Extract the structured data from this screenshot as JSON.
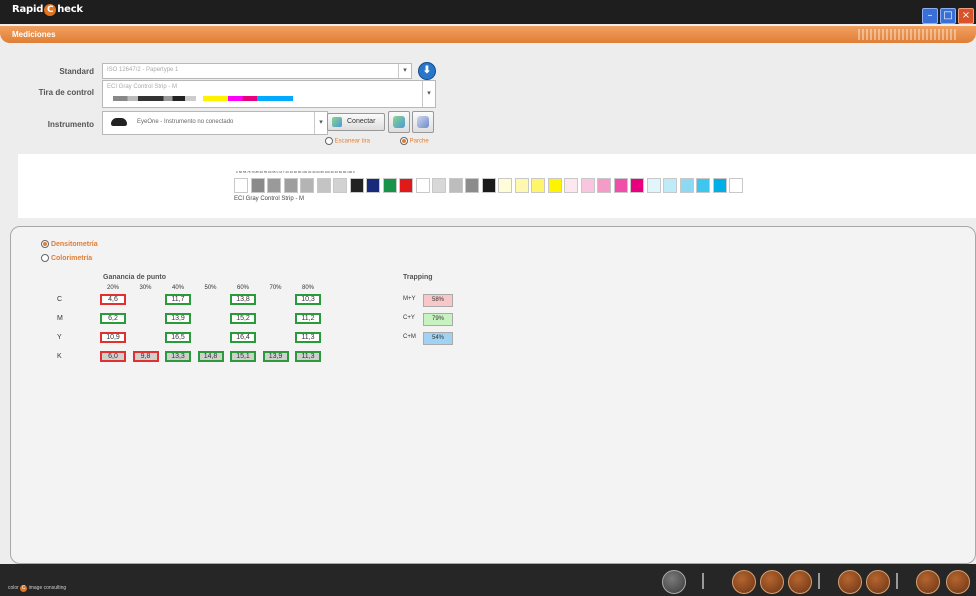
{
  "app": {
    "title_pre": "Rapid",
    "title_c": "C",
    "title_post": "heck"
  },
  "tab": {
    "label": "Mediciones"
  },
  "form": {
    "standard_label": "Standard",
    "standard_value": "ISO 12647/2 - Papertype 1",
    "tira_label": "Tira de control",
    "tira_value": "ECI Gray Control Strip - M",
    "instrumento_label": "Instrumento",
    "instrumento_value": "EyeOne - Instrumento no conectado",
    "conectar_label": "Conectar",
    "mode_escanear": "Escanear tira",
    "mode_parche": "Parche"
  },
  "strip": {
    "caption": "ECI Gray Control Strip - M",
    "patch_colors": [
      "#ffffff",
      "#8a8a8a",
      "#9a9a9a",
      "#9e9e9e",
      "#b4b4b4",
      "#c4c4c4",
      "#d2d2d2",
      "#222222",
      "#1a2a7a",
      "#17934a",
      "#e01a1a",
      "#ffffff",
      "#d8d8d8",
      "#bdbdbd",
      "#8c8c8c",
      "#1a1a1a",
      "#fffdd8",
      "#fff9b0",
      "#fff56a",
      "#fff400",
      "#fde8f0",
      "#f9c6df",
      "#f59bc8",
      "#ef4fa8",
      "#e8007e",
      "#e2f5fb",
      "#bfeaf7",
      "#8dd9f3",
      "#3ec6ee",
      "#00aee8",
      "#ffffff"
    ],
    "scale_text": "K  50 55 75 70 85 60 55 90 65 C M Y 20 40 60 80 100 20 40 60 80 100 20 40 60 80 100 K"
  },
  "results": {
    "densitometria": "Densitometría",
    "colorimetria": "Colorimetría",
    "ganancia_title": "Ganancia de punto",
    "percents": [
      "20%",
      "30%",
      "40%",
      "50%",
      "60%",
      "70%",
      "80%"
    ],
    "rows": [
      {
        "label": "C",
        "cells": [
          {
            "v": "4,6",
            "c": "red",
            "col": 0
          },
          {
            "v": "11,7",
            "c": "green",
            "col": 2
          },
          {
            "v": "13,8",
            "c": "green",
            "col": 4
          },
          {
            "v": "10,3",
            "c": "green",
            "col": 6
          }
        ]
      },
      {
        "label": "M",
        "cells": [
          {
            "v": "6,2",
            "c": "green",
            "col": 0
          },
          {
            "v": "13,9",
            "c": "green",
            "col": 2
          },
          {
            "v": "15,2",
            "c": "green",
            "col": 4
          },
          {
            "v": "11,2",
            "c": "green",
            "col": 6
          }
        ]
      },
      {
        "label": "Y",
        "cells": [
          {
            "v": "10,9",
            "c": "red",
            "col": 0
          },
          {
            "v": "16,5",
            "c": "green",
            "col": 2
          },
          {
            "v": "16,4",
            "c": "green",
            "col": 4
          },
          {
            "v": "11,3",
            "c": "green",
            "col": 6
          }
        ]
      },
      {
        "label": "K",
        "cells": [
          {
            "v": "6,0",
            "c": "red gray",
            "col": 0
          },
          {
            "v": "9,8",
            "c": "red gray",
            "col": 1
          },
          {
            "v": "13,3",
            "c": "green gray",
            "col": 2
          },
          {
            "v": "14,8",
            "c": "green gray",
            "col": 3
          },
          {
            "v": "15,1",
            "c": "green gray",
            "col": 4
          },
          {
            "v": "13,9",
            "c": "green gray",
            "col": 5
          },
          {
            "v": "11,3",
            "c": "green gray",
            "col": 6
          }
        ]
      }
    ],
    "trapping_title": "Trapping",
    "trapping": [
      {
        "label": "M+Y",
        "value": "58%",
        "color": "#f8c8c8"
      },
      {
        "label": "C+Y",
        "value": "79%",
        "color": "#c8f3c0"
      },
      {
        "label": "C+M",
        "value": "54%",
        "color": "#9fd2f3"
      }
    ]
  },
  "footer": {
    "brand_pre": "color",
    "brand_c": "C",
    "brand_post": "image consulting"
  }
}
